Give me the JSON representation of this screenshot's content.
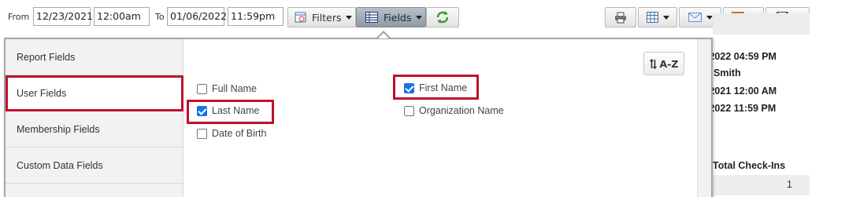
{
  "toolbar": {
    "from_label": "From",
    "from_date": "12/23/2021",
    "from_time": "12:00am",
    "to_label": "To",
    "to_date": "01/06/2022",
    "to_time": "11:59pm",
    "filters_label": "Filters",
    "fields_label": "Fields",
    "icons": [
      "calendar-filter-icon",
      "table-icon",
      "refresh-icon",
      "print-icon",
      "grid-icon",
      "email-icon",
      "report-icon",
      "save-icon"
    ],
    "accent_active": "#97a3ae"
  },
  "background": {
    "line1": "/2022 04:59 PM",
    "line2": "Smith",
    "line3": "/2021 12:00 AM",
    "line4": "/2022 11:59 PM",
    "column_header": "Total Check-Ins",
    "cell_value": "1"
  },
  "popup": {
    "sidebar": {
      "items": [
        {
          "label": "Report Fields"
        },
        {
          "label": "User Fields"
        },
        {
          "label": "Membership Fields"
        },
        {
          "label": "Custom Data Fields"
        }
      ],
      "selected": "User Fields"
    },
    "sort_label": "A-Z",
    "fields": [
      {
        "label": "Full Name",
        "checked": false
      },
      {
        "label": "Last Name",
        "checked": true
      },
      {
        "label": "Date of Birth",
        "checked": false
      },
      {
        "label": "First Name",
        "checked": true
      },
      {
        "label": "Organization Name",
        "checked": false
      }
    ],
    "highlight_color": "#c0112e",
    "checkbox_color": "#1a73e8"
  }
}
